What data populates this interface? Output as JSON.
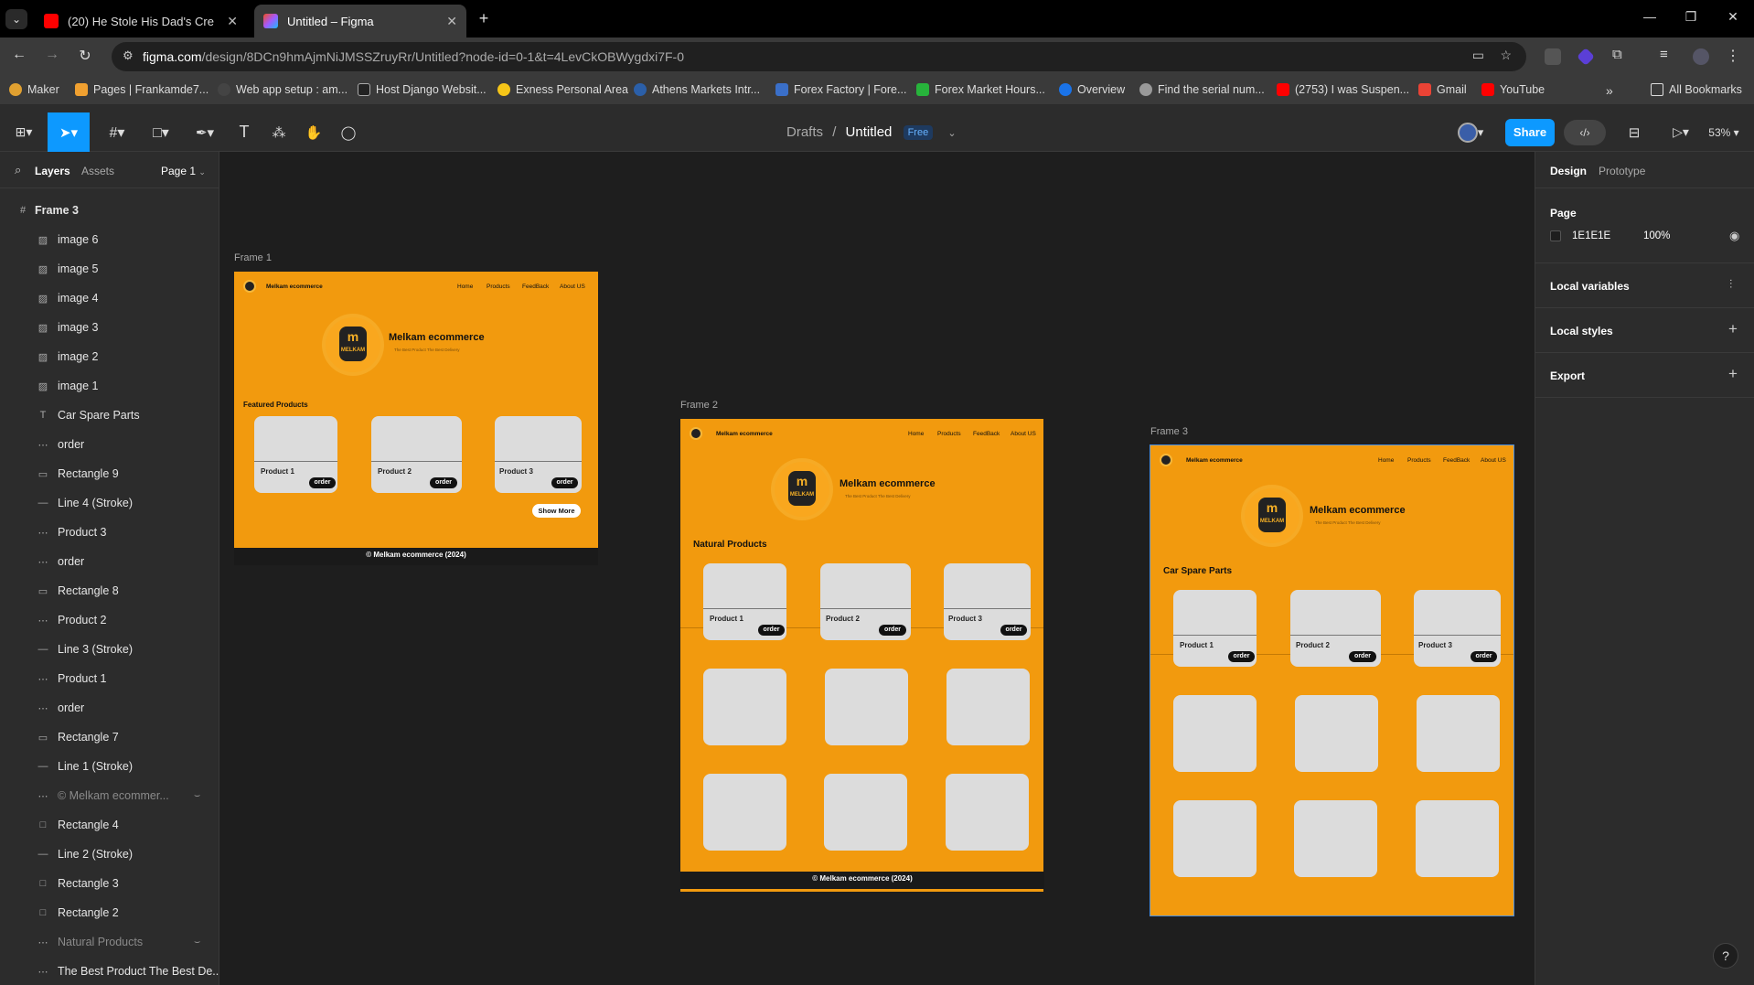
{
  "browser": {
    "tabs": [
      {
        "title": "(20) He Stole His Dad's Cre"
      },
      {
        "title": "Untitled – Figma"
      }
    ],
    "url_domain": "figma.com",
    "url_path": "/design/8DCn9hmAjmNiJMSSZruyRr/Untitled?node-id=0-1&t=4LevCkOBWygdxi7F-0",
    "bookmarks": [
      "Maker",
      "Pages | Frankamde7...",
      "Web app setup : am...",
      "Host Django Websit...",
      "Exness Personal Area",
      "Athens Markets Intr...",
      "Forex Factory | Fore...",
      "Forex Market Hours...",
      "Overview",
      "Find the serial num...",
      "(2753) I was Suspen...",
      "Gmail",
      "YouTube"
    ],
    "all_bookmarks": "All Bookmarks"
  },
  "figma": {
    "breadcrumb_parent": "Drafts",
    "file_name": "Untitled",
    "plan_badge": "Free",
    "share_label": "Share",
    "zoom": "53%",
    "left": {
      "tab_layers": "Layers",
      "tab_assets": "Assets",
      "page": "Page 1",
      "layers": [
        {
          "name": "Frame 3",
          "icon": "frame-icon"
        },
        {
          "name": "image 6",
          "icon": "image-icon"
        },
        {
          "name": "image 5",
          "icon": "image-icon"
        },
        {
          "name": "image 4",
          "icon": "image-icon"
        },
        {
          "name": "image 3",
          "icon": "image-icon"
        },
        {
          "name": "image 2",
          "icon": "image-icon"
        },
        {
          "name": "image 1",
          "icon": "image-icon"
        },
        {
          "name": "Car Spare Parts",
          "icon": "text-icon"
        },
        {
          "name": "order",
          "icon": "group-icon"
        },
        {
          "name": "Rectangle 9",
          "icon": "rounded-rect-icon"
        },
        {
          "name": "Line 4 (Stroke)",
          "icon": "line-icon"
        },
        {
          "name": "Product 3",
          "icon": "group-icon"
        },
        {
          "name": "order",
          "icon": "group-icon"
        },
        {
          "name": "Rectangle 8",
          "icon": "rounded-rect-icon"
        },
        {
          "name": "Product 2",
          "icon": "group-icon"
        },
        {
          "name": "Line 3 (Stroke)",
          "icon": "line-icon"
        },
        {
          "name": "Product 1",
          "icon": "group-icon"
        },
        {
          "name": "order",
          "icon": "group-icon"
        },
        {
          "name": "Rectangle 7",
          "icon": "rounded-rect-icon"
        },
        {
          "name": "Line 1 (Stroke)",
          "icon": "line-icon"
        },
        {
          "name": "© Melkam ecommer...",
          "icon": "group-icon"
        },
        {
          "name": "Rectangle 4",
          "icon": "rect-icon"
        },
        {
          "name": "Line 2 (Stroke)",
          "icon": "line-icon"
        },
        {
          "name": "Rectangle 3",
          "icon": "rect-icon"
        },
        {
          "name": "Rectangle 2",
          "icon": "rect-icon"
        },
        {
          "name": "Natural Products",
          "icon": "group-icon"
        },
        {
          "name": "The Best Product The Best De...",
          "icon": "group-icon"
        }
      ]
    },
    "right": {
      "tab_design": "Design",
      "tab_prototype": "Prototype",
      "page_label": "Page",
      "page_color": "1E1E1E",
      "page_opacity": "100%",
      "local_variables": "Local variables",
      "local_styles": "Local styles",
      "export": "Export"
    },
    "frames": [
      {
        "label": "Frame 1",
        "brand": "Melkam ecommerce",
        "nav": [
          "Home",
          "Products",
          "FeedBack",
          "About US"
        ],
        "hero_title": "Melkam ecommerce",
        "hero_sub": "The Best Product The Best Delivery",
        "logo_text": "MELKAM",
        "section": "Featured Products",
        "products": [
          "Product 1",
          "Product 2",
          "Product 3"
        ],
        "order_label": "order",
        "show_more": "Show More",
        "footer": "© Melkam ecommerce (2024)"
      },
      {
        "label": "Frame 2",
        "brand": "Melkam ecommerce",
        "nav": [
          "Home",
          "Products",
          "FeedBack",
          "About US"
        ],
        "hero_title": "Melkam ecommerce",
        "hero_sub": "The Best Product The Best Delivery",
        "logo_text": "MELKAM",
        "section": "Natural Products",
        "products": [
          "Product 1",
          "Product 2",
          "Product 3"
        ],
        "order_label": "order",
        "footer": "© Melkam ecommerce (2024)"
      },
      {
        "label": "Frame 3",
        "brand": "Melkam ecommerce",
        "nav": [
          "Home",
          "Products",
          "FeedBack",
          "About US"
        ],
        "hero_title": "Melkam ecommerce",
        "hero_sub": "The Best Product The Best Delivery",
        "logo_text": "MELKAM",
        "section": "Car Spare Parts",
        "products": [
          "Product 1",
          "Product 2",
          "Product 3"
        ],
        "order_label": "order"
      }
    ]
  },
  "colors": {
    "accent": "#0d99ff",
    "frame_bg": "#f29a0e",
    "canvas": "#1e1e1e"
  }
}
